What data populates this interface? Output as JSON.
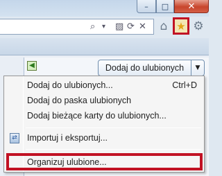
{
  "window": {
    "minimize_glyph": "–",
    "maximize_glyph": "□",
    "close_glyph": "✕"
  },
  "address_bar": {
    "search_glyph": "⌕",
    "dropdown_glyph": "▾",
    "refresh_glyph": "⟳",
    "stop_glyph": "✕"
  },
  "toolbar": {
    "home_icon": "home-icon",
    "favorites_icon": "star-icon",
    "tools_icon": "gear-icon",
    "favorites_highlight_color": "#c11224"
  },
  "favorites_panel": {
    "back_glyph": "◀",
    "add_button_label": "Dodaj do ulubionych",
    "add_button_arrow": "▼"
  },
  "menu": {
    "items": [
      {
        "label": "Dodaj do ulubionych...",
        "shortcut": "Ctrl+D"
      },
      {
        "label": "Dodaj do paska ulubionych",
        "shortcut": ""
      },
      {
        "label": "Dodaj bieżące karty do ulubionych...",
        "shortcut": ""
      },
      {
        "label": "Importuj i eksportuj...",
        "shortcut": ""
      },
      {
        "label": "Organizuj ulubione...",
        "shortcut": ""
      }
    ],
    "highlight_color": "#c11224"
  }
}
